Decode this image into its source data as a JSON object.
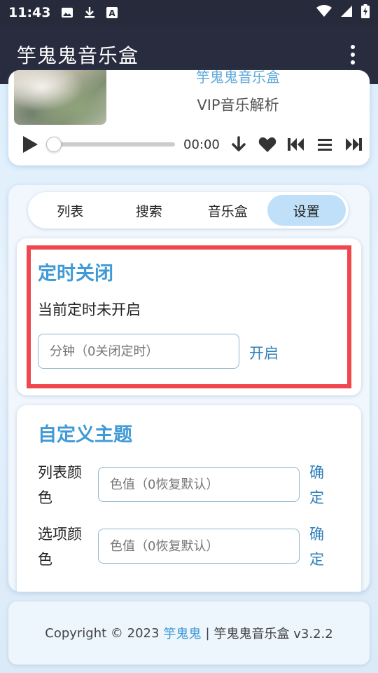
{
  "status_bar": {
    "time": "11:43",
    "icons_left": [
      "image-icon",
      "download-icon",
      "font-a-icon"
    ],
    "icons_right": [
      "wifi-icon",
      "signal-icon",
      "battery-charging-icon"
    ]
  },
  "app_bar": {
    "title": "竽鬼鬼音乐盒",
    "menu_icon": "more-vertical-icon"
  },
  "player": {
    "song_name": "竽鬼鬼音乐盒",
    "artist": "VIP音乐解析",
    "time": "00:00",
    "progress": 0,
    "controls": [
      "play-icon",
      "download-icon",
      "heart-icon",
      "skip-previous-icon",
      "playlist-icon",
      "skip-next-icon"
    ]
  },
  "tabs": [
    {
      "label": "列表",
      "active": false
    },
    {
      "label": "搜索",
      "active": false
    },
    {
      "label": "音乐盒",
      "active": false
    },
    {
      "label": "设置",
      "active": true
    }
  ],
  "timer": {
    "title": "定时关闭",
    "status": "当前定时未开启",
    "input_placeholder": "分钟（0关闭定时）",
    "button": "开启"
  },
  "theme": {
    "title": "自定义主题",
    "rows": [
      {
        "label": "列表颜色",
        "placeholder": "色值（0恢复默认）",
        "button": "确定"
      },
      {
        "label": "选项颜色",
        "placeholder": "色值（0恢复默认）",
        "button": "确定"
      }
    ]
  },
  "footer": {
    "prefix": "Copyright © 2023",
    "author": "竽鬼鬼",
    "separator": "|",
    "suffix": "竽鬼鬼音乐盒 v3.2.2"
  },
  "colors": {
    "accent": "#3f9ad6",
    "appbar": "#282c3e",
    "highlight": "#f0474f",
    "active_tab": "#bfe0f8"
  }
}
